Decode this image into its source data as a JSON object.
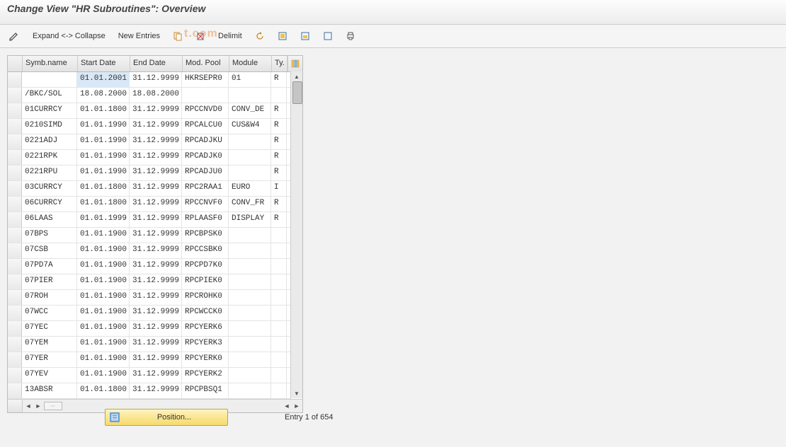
{
  "title": "Change View \"HR Subroutines\": Overview",
  "toolbar": {
    "expand_collapse": "Expand <-> Collapse",
    "new_entries": "New Entries",
    "delimit": "Delimit"
  },
  "watermark": "t.com",
  "columns": {
    "name": "Symb.name",
    "start": "Start Date",
    "end": "End Date",
    "pool": "Mod. Pool",
    "module": "Module",
    "type": "Ty."
  },
  "rows": [
    {
      "name": "",
      "start": "01.01.2001",
      "end": "31.12.9999",
      "pool": "HKRSEPR0",
      "module": "01",
      "type": "R",
      "hl": true
    },
    {
      "name": "/BKC/SOL",
      "start": "18.08.2000",
      "end": "18.08.2000",
      "pool": "",
      "module": "",
      "type": ""
    },
    {
      "name": "01CURRCY",
      "start": "01.01.1800",
      "end": "31.12.9999",
      "pool": "RPCCNVD0",
      "module": "CONV_DE",
      "type": "R"
    },
    {
      "name": "0210SIMD",
      "start": "01.01.1990",
      "end": "31.12.9999",
      "pool": "RPCALCU0",
      "module": "CUS&W4",
      "type": "R"
    },
    {
      "name": "0221ADJ",
      "start": "01.01.1990",
      "end": "31.12.9999",
      "pool": "RPCADJKU",
      "module": "",
      "type": "R"
    },
    {
      "name": "0221RPK",
      "start": "01.01.1990",
      "end": "31.12.9999",
      "pool": "RPCADJK0",
      "module": "",
      "type": "R"
    },
    {
      "name": "0221RPU",
      "start": "01.01.1990",
      "end": "31.12.9999",
      "pool": "RPCADJU0",
      "module": "",
      "type": "R"
    },
    {
      "name": "03CURRCY",
      "start": "01.01.1800",
      "end": "31.12.9999",
      "pool": "RPC2RAA1",
      "module": "EURO",
      "type": "I"
    },
    {
      "name": "06CURRCY",
      "start": "01.01.1800",
      "end": "31.12.9999",
      "pool": "RPCCNVF0",
      "module": "CONV_FR",
      "type": "R"
    },
    {
      "name": "06LAAS",
      "start": "01.01.1999",
      "end": "31.12.9999",
      "pool": "RPLAASF0",
      "module": "DISPLAY",
      "type": "R"
    },
    {
      "name": "07BPS",
      "start": "01.01.1900",
      "end": "31.12.9999",
      "pool": "RPCBPSK0",
      "module": "",
      "type": ""
    },
    {
      "name": "07CSB",
      "start": "01.01.1900",
      "end": "31.12.9999",
      "pool": "RPCCSBK0",
      "module": "",
      "type": ""
    },
    {
      "name": "07PD7A",
      "start": "01.01.1900",
      "end": "31.12.9999",
      "pool": "RPCPD7K0",
      "module": "",
      "type": ""
    },
    {
      "name": "07PIER",
      "start": "01.01.1900",
      "end": "31.12.9999",
      "pool": "RPCPIEK0",
      "module": "",
      "type": ""
    },
    {
      "name": "07ROH",
      "start": "01.01.1900",
      "end": "31.12.9999",
      "pool": "RPCROHK0",
      "module": "",
      "type": ""
    },
    {
      "name": "07WCC",
      "start": "01.01.1900",
      "end": "31.12.9999",
      "pool": "RPCWCCK0",
      "module": "",
      "type": ""
    },
    {
      "name": "07YEC",
      "start": "01.01.1900",
      "end": "31.12.9999",
      "pool": "RPCYERK6",
      "module": "",
      "type": ""
    },
    {
      "name": "07YEM",
      "start": "01.01.1900",
      "end": "31.12.9999",
      "pool": "RPCYERK3",
      "module": "",
      "type": ""
    },
    {
      "name": "07YER",
      "start": "01.01.1900",
      "end": "31.12.9999",
      "pool": "RPCYERK0",
      "module": "",
      "type": ""
    },
    {
      "name": "07YEV",
      "start": "01.01.1900",
      "end": "31.12.9999",
      "pool": "RPCYERK2",
      "module": "",
      "type": ""
    },
    {
      "name": "13ABSR",
      "start": "01.01.1800",
      "end": "31.12.9999",
      "pool": "RPCPBSQ1",
      "module": "",
      "type": ""
    }
  ],
  "footer": {
    "position_label": "Position...",
    "status": "Entry 1 of 654"
  }
}
